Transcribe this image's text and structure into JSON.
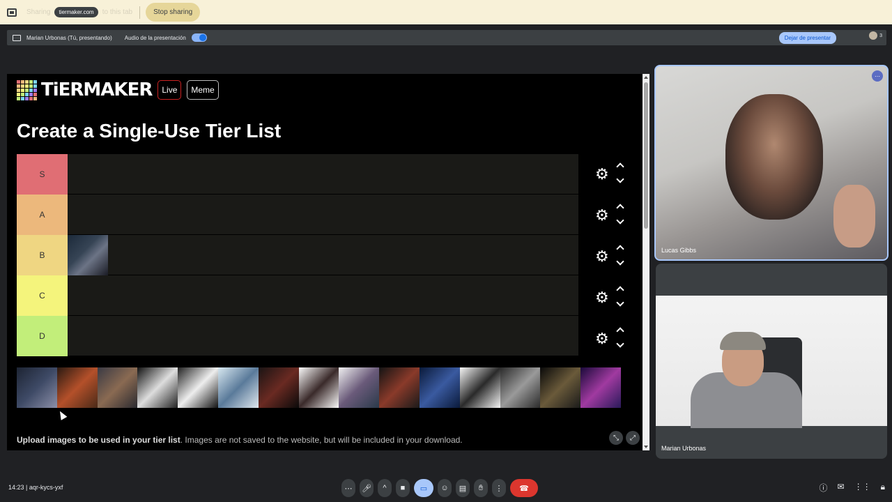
{
  "share_bar": {
    "faded_left": "Sharing",
    "domain": "tiermaker.com",
    "faded_right": "to this tab",
    "stop_label": "Stop sharing"
  },
  "present_bar": {
    "presenter": "Marian Urbonas (Tú, presentando)",
    "audio_label": "Audio de la presentación",
    "stop_present_label": "Dejar de presentar",
    "people_count": "3"
  },
  "tiermaker": {
    "logo": "TiERMAKER",
    "live_label": "Live",
    "meme_label": "Meme",
    "title": "Create a Single-Use Tier List",
    "tiers": [
      {
        "label": "S",
        "color": "#e06e74"
      },
      {
        "label": "A",
        "color": "#ecb87c"
      },
      {
        "label": "B",
        "color": "#efd682"
      },
      {
        "label": "C",
        "color": "#f4f47c"
      },
      {
        "label": "D",
        "color": "#c2ee7a"
      }
    ],
    "pool_count": 15,
    "upload_bold": "Upload images to be used in your tier list",
    "upload_rest": ". Images are not saved to the website, but will be included in your download."
  },
  "participants": {
    "lucas": "Lucas Gibbs",
    "marian": "Marian Urbonas"
  },
  "footer": {
    "time": "14:23",
    "separator": "|",
    "meeting_code": "aqr-kycs-yxf"
  },
  "icons": {
    "gear": "⚙",
    "more": "⋯"
  }
}
